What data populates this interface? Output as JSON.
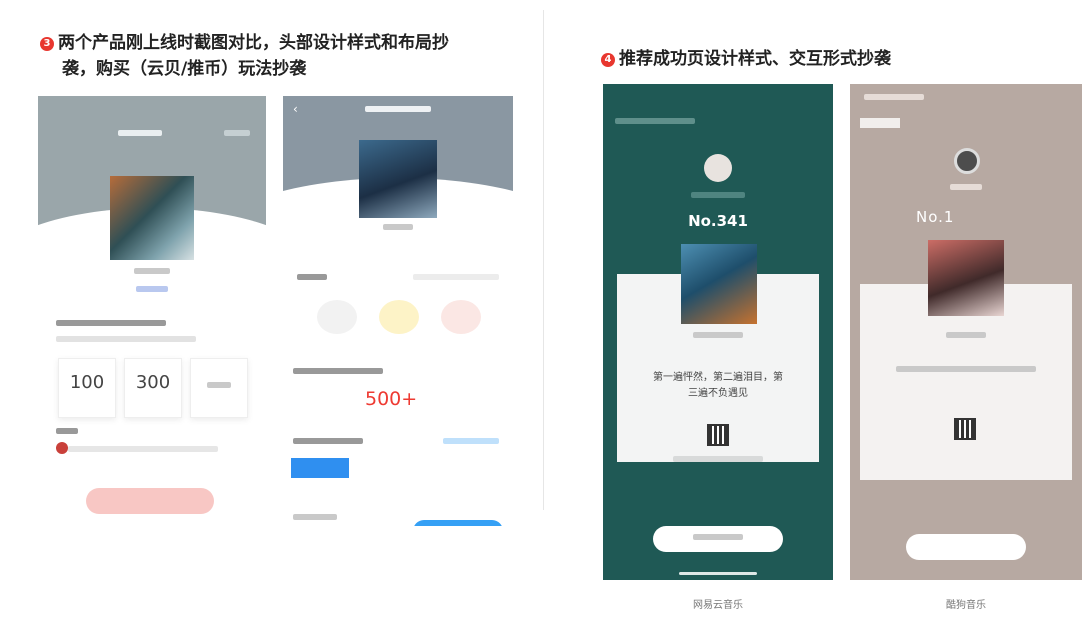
{
  "left_section": {
    "number": "3",
    "title_line1": "两个产品刚上线时截图对比，头部设计样式和布局抄",
    "title_line2": "袭，购买（云贝/推币）玩法抄袭",
    "phone1": {
      "stat_values": [
        "100",
        "300"
      ]
    },
    "phone2": {
      "count_text": "500+"
    }
  },
  "right_section": {
    "number": "4",
    "title": "推荐成功页设计样式、交互形式抄袭",
    "phone3": {
      "rank_text": "No.341",
      "quote_line1": "第一遍怦然，第二遍泪目，第",
      "quote_line2": "三遍不负遇见",
      "caption": "网易云音乐"
    },
    "phone4": {
      "rank_text": "No.1",
      "caption": "酷狗音乐"
    }
  },
  "colors": {
    "accent_red": "#e8372f",
    "netease_green": "#1f5955",
    "kugou_taupe": "#b7a9a2",
    "count_red": "#ee3a32",
    "buy_blue": "#35a0f5"
  }
}
